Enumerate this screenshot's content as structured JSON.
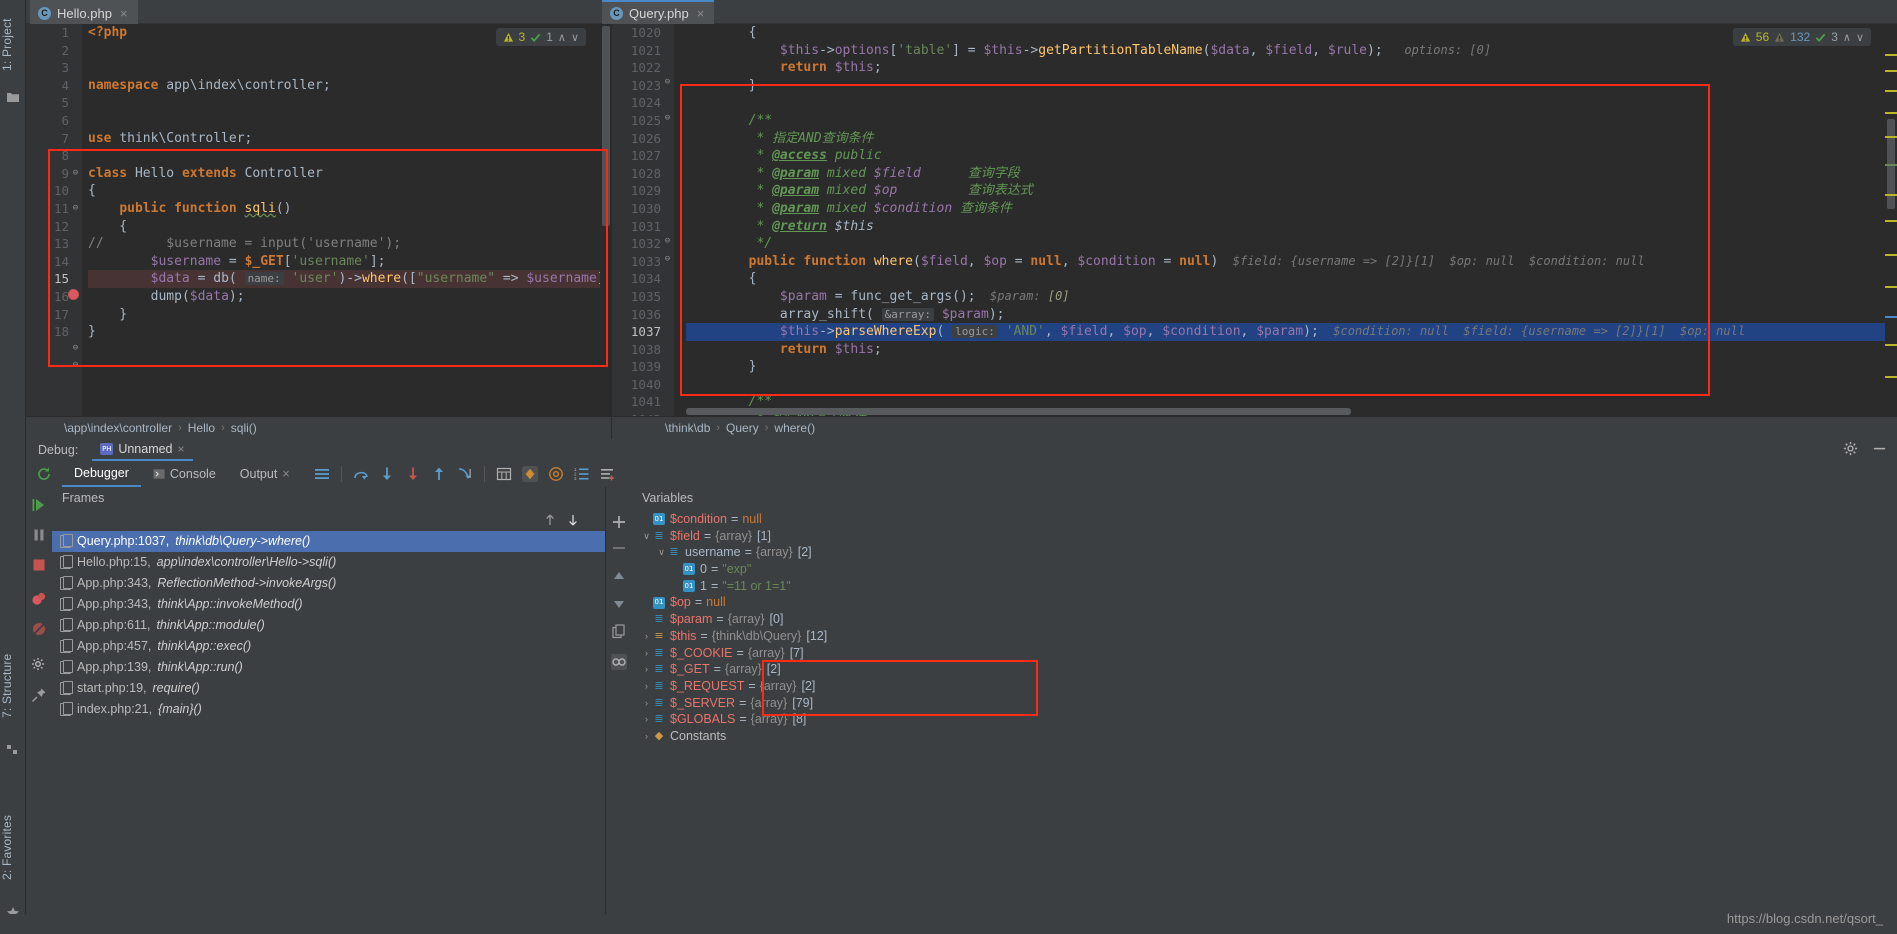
{
  "left_strip": {
    "project_label": "1: Project",
    "structure_label": "7: Structure",
    "favorites_label": "2: Favorites",
    "folder_icon": "folder-icon",
    "star_icon": "star-icon"
  },
  "tabs": [
    {
      "label": "Hello.php",
      "icon": "php-class-icon",
      "close": "×",
      "active": false
    },
    {
      "label": "Query.php",
      "icon": "php-class-icon",
      "close": "×",
      "active": true
    }
  ],
  "editor_left": {
    "file": "Hello.php",
    "first_line": 1,
    "breakpoint_line": 15,
    "inspect": {
      "warn_icon": "warning-triangle-icon",
      "warn_count": "3",
      "ok_icon": "check-icon",
      "ok_count": "1",
      "up": "∧",
      "down": "∨"
    },
    "lines": [
      {
        "n": 1,
        "html": "<span class=\"kw\">&lt;?php</span>"
      },
      {
        "n": 2,
        "html": ""
      },
      {
        "n": 3,
        "html": ""
      },
      {
        "n": 4,
        "html": "<span class=\"kw\">namespace</span> <span class=\"gray\">app\\index\\controller</span>;"
      },
      {
        "n": 5,
        "html": ""
      },
      {
        "n": 6,
        "html": ""
      },
      {
        "n": 7,
        "html": "<span class=\"kw\">use</span> <span class=\"gray\">think\\Controller</span>;"
      },
      {
        "n": 8,
        "html": ""
      },
      {
        "n": 9,
        "html": "<span class=\"kw\">class</span> <span class=\"cls\">Hello</span> <span class=\"kw\">extends</span> <span class=\"cls\">Controller</span>"
      },
      {
        "n": 10,
        "html": "{"
      },
      {
        "n": 11,
        "html": "    <span class=\"kw\">public function</span> <span class=\"fn squig\">sqli</span>()"
      },
      {
        "n": 12,
        "html": "    {"
      },
      {
        "n": 13,
        "html": "<span class=\"cmt\">//        $username = input('username');</span>"
      },
      {
        "n": 14,
        "html": "        <span class=\"var\">$username</span> = <span class=\"kw\">$_GET</span>[<span class=\"str\">'username'</span>];"
      },
      {
        "n": 15,
        "html": "        <span class=\"var\">$data</span> = <span class=\"gray\">db</span>( <span class=\"pname\">name:</span> <span class=\"str\">'user'</span>)-&gt;<span class=\"fn\">where</span>([<span class=\"str\">\"username\"</span> =&gt; <span class=\"var\">$username</span>])-&gt;<span class=\"fn squig2\">select</span>();"
      },
      {
        "n": 16,
        "html": "        <span class=\"gray\">dump</span>(<span class=\"var\">$data</span>);"
      },
      {
        "n": 17,
        "html": "    }"
      },
      {
        "n": 18,
        "html": "}"
      }
    ],
    "breadcrumbs": [
      "\\app\\index\\controller",
      "Hello",
      "sqli()"
    ]
  },
  "editor_right": {
    "file": "Query.php",
    "first_line": 1020,
    "selected_line": 1037,
    "inspect": {
      "warn_icon": "warning-triangle-icon",
      "warn_count": "56",
      "warn2_icon": "warning-triangle-gray-icon",
      "warn2_count": "132",
      "ok_icon": "check-icon",
      "ok_count": "3",
      "up": "∧",
      "down": "∨"
    },
    "lines": [
      {
        "n": 1020,
        "html": "        {"
      },
      {
        "n": 1021,
        "html": "            <span class=\"var\">$this</span>-&gt;<span class=\"var\">options</span>[<span class=\"str\">'table'</span>] = <span class=\"var\">$this</span>-&gt;<span class=\"fn\">getPartitionTableName</span>(<span class=\"var\">$data</span>, <span class=\"var\">$field</span>, <span class=\"var\">$rule</span>);<span class=\"hint\">   options: [0]</span>"
      },
      {
        "n": 1022,
        "html": "            <span class=\"kw\">return</span> <span class=\"var\">$this</span>;"
      },
      {
        "n": 1023,
        "html": "        }"
      },
      {
        "n": 1024,
        "html": ""
      },
      {
        "n": 1025,
        "html": "        <span class=\"doc\">/**</span>"
      },
      {
        "n": 1026,
        "html": "         <span class=\"doc\">* 指定AND查询条件</span>"
      },
      {
        "n": 1027,
        "html": "         <span class=\"doc\">* </span><span class=\"doctag\">@access</span><span class=\"doc\"> public</span>"
      },
      {
        "n": 1028,
        "html": "         <span class=\"doc\">* </span><span class=\"doctag\">@param</span><span class=\"doc\"> mixed </span><span class=\"var\" style=\"font-style:italic\">$field</span><span class=\"doc\">      查询字段</span>"
      },
      {
        "n": 1029,
        "html": "         <span class=\"doc\">* </span><span class=\"doctag\">@param</span><span class=\"doc\"> mixed </span><span class=\"var\" style=\"font-style:italic\">$op</span><span class=\"doc\">         查询表达式</span>"
      },
      {
        "n": 1030,
        "html": "         <span class=\"doc\">* </span><span class=\"doctag\">@param</span><span class=\"doc\"> mixed </span><span class=\"var\" style=\"font-style:italic\">$condition</span><span class=\"doc\"> 查询条件</span>"
      },
      {
        "n": 1031,
        "html": "         <span class=\"doc\">* </span><span class=\"doctag\">@return</span><span class=\"doc\"> </span><span class=\"gray\" style=\"font-style:italic\">$this</span>"
      },
      {
        "n": 1032,
        "html": "         <span class=\"doc\">*/</span>"
      },
      {
        "n": 1033,
        "html": "        <span class=\"kw\">public function</span> <span class=\"fn\">where</span>(<span class=\"var\">$field</span>, <span class=\"var\">$op</span> = <span class=\"kw\">null</span>, <span class=\"var\">$condition</span> = <span class=\"kw\">null</span>)<span class=\"hint\">  $field: {username =&gt; [2]}[1]  $op: null  $condition: null</span>"
      },
      {
        "n": 1034,
        "html": "        {"
      },
      {
        "n": 1035,
        "html": "            <span class=\"var\">$param</span> = <span class=\"gray\">func_get_args</span>();<span class=\"hint\">  $param: </span><span class=\"hintv\">[0]</span>"
      },
      {
        "n": 1036,
        "html": "            <span class=\"gray\">array_shift</span>( <span class=\"pname\">&amp;array:</span> <span class=\"var\">$param</span>);"
      },
      {
        "n": 1037,
        "html": "            <span class=\"var\">$this</span>-&gt;<span class=\"fn\">parseWhereExp</span>( <span class=\"pname\">logic:</span> <span class=\"str\">'AND'</span>, <span class=\"var\">$field</span>, <span class=\"var\">$op</span>, <span class=\"var\">$condition</span>, <span class=\"var\">$param</span>);<span class=\"hint\">  $condition: null  $field: {username =&gt; [2]}[1]  $op: null</span>"
      },
      {
        "n": 1038,
        "html": "            <span class=\"kw\">return</span> <span class=\"var\">$this</span>;"
      },
      {
        "n": 1039,
        "html": "        }"
      },
      {
        "n": 1040,
        "html": ""
      },
      {
        "n": 1041,
        "html": "        <span class=\"doc\">/**</span>"
      },
      {
        "n": 1042,
        "html": "         <span class=\"doc\">* 指定OR查询条件</span>"
      }
    ],
    "breadcrumbs": [
      "\\think\\db",
      "Query",
      "where()"
    ]
  },
  "debug": {
    "label": "Debug:",
    "session_name": "Unnamed",
    "session_icon": "php-debug-icon",
    "session_close": "×",
    "settings_icon": "gear-icon",
    "hide_icon": "minimize-icon",
    "rerun_icon": "rerun-icon",
    "tabs": [
      {
        "label": "Debugger",
        "icon": "",
        "active": true
      },
      {
        "label": "Console",
        "icon": "console-icon",
        "active": false
      },
      {
        "label": "Output",
        "icon": "",
        "active": false,
        "close": "×"
      }
    ],
    "toolbar_icons": [
      "layout-icon",
      "step-over-icon",
      "step-into-icon",
      "force-step-into-icon",
      "step-out-icon",
      "run-to-cursor-icon",
      "evaluate-expression-icon",
      "mute-breakpoints-icon",
      "at-icon",
      "watches-icon",
      "settings-list-icon"
    ],
    "side_icons": [
      "resume-icon",
      "pause-icon",
      "stop-icon",
      "view-breakpoints-icon",
      "mute-breakpoints-side-icon",
      "settings-side-icon",
      "pin-icon"
    ],
    "frames": {
      "title": "Frames",
      "up_icon": "arrow-up-icon",
      "down_icon": "arrow-down-icon",
      "rows": [
        {
          "file": "Query.php:1037,",
          "fn": "think\\db\\Query->where()",
          "selected": true
        },
        {
          "file": "Hello.php:15,",
          "fn": "app\\index\\controller\\Hello->sqli()",
          "selected": false
        },
        {
          "file": "App.php:343,",
          "fn": "ReflectionMethod->invokeArgs()",
          "selected": false
        },
        {
          "file": "App.php:343,",
          "fn": "think\\App::invokeMethod()",
          "selected": false
        },
        {
          "file": "App.php:611,",
          "fn": "think\\App::module()",
          "selected": false
        },
        {
          "file": "App.php:457,",
          "fn": "think\\App::exec()",
          "selected": false
        },
        {
          "file": "App.php:139,",
          "fn": "think\\App::run()",
          "selected": false
        },
        {
          "file": "start.php:19,",
          "fn": "require()",
          "selected": false
        },
        {
          "file": "index.php:21,",
          "fn": "{main}()",
          "selected": false
        }
      ]
    },
    "variables": {
      "title": "Variables",
      "add_icon": "plus-icon",
      "remove_icon": "minus-icon",
      "up_icon": "triangle-up-icon",
      "down_icon": "triangle-down-icon",
      "copy_icon": "copy-icon",
      "watch_icon": "watches-toggle-icon",
      "rows": [
        {
          "indent": 0,
          "twisty": "",
          "ico": "prim",
          "glyph": "01",
          "name": "$condition",
          "eq": "=",
          "value": "null",
          "vclass": "vnull"
        },
        {
          "indent": 0,
          "twisty": "∨",
          "ico": "arr",
          "glyph": "≣",
          "name": "$field",
          "eq": "=",
          "type": "{array}",
          "count": "[1]"
        },
        {
          "indent": 1,
          "twisty": "∨",
          "ico": "arr",
          "glyph": "≣",
          "name": "username",
          "nameclass": "key",
          "eq": "=",
          "type": "{array}",
          "count": "[2]"
        },
        {
          "indent": 2,
          "twisty": "",
          "ico": "prim",
          "glyph": "01",
          "name": "0",
          "nameclass": "key",
          "eq": "=",
          "value": "\"exp\"",
          "vclass": "vstr"
        },
        {
          "indent": 2,
          "twisty": "",
          "ico": "prim",
          "glyph": "01",
          "name": "1",
          "nameclass": "key",
          "eq": "=",
          "value": "\"=11 or 1=1\"",
          "vclass": "vstr"
        },
        {
          "indent": 0,
          "twisty": "",
          "ico": "prim",
          "glyph": "01",
          "name": "$op",
          "eq": "=",
          "value": "null",
          "vclass": "vnull"
        },
        {
          "indent": 0,
          "twisty": "",
          "ico": "arr",
          "glyph": "≣",
          "name": "$param",
          "eq": "=",
          "type": "{array}",
          "count": "[0]"
        },
        {
          "indent": 0,
          "twisty": "›",
          "ico": "obj",
          "glyph": "≡",
          "name": "$this",
          "eq": "=",
          "type": "{think\\db\\Query}",
          "count": "[12]"
        },
        {
          "indent": 0,
          "twisty": "›",
          "ico": "arr",
          "glyph": "≣",
          "name": "$_COOKIE",
          "eq": "=",
          "type": "{array}",
          "count": "[7]"
        },
        {
          "indent": 0,
          "twisty": "›",
          "ico": "arr",
          "glyph": "≣",
          "name": "$_GET",
          "eq": "=",
          "type": "{array}",
          "count": "[2]"
        },
        {
          "indent": 0,
          "twisty": "›",
          "ico": "arr",
          "glyph": "≣",
          "name": "$_REQUEST",
          "eq": "=",
          "type": "{array}",
          "count": "[2]"
        },
        {
          "indent": 0,
          "twisty": "›",
          "ico": "arr",
          "glyph": "≣",
          "name": "$_SERVER",
          "eq": "=",
          "type": "{array}",
          "count": "[79]"
        },
        {
          "indent": 0,
          "twisty": "›",
          "ico": "arr",
          "glyph": "≣",
          "name": "$GLOBALS",
          "eq": "=",
          "type": "{array}",
          "count": "[8]"
        },
        {
          "indent": 0,
          "twisty": "›",
          "ico": "const",
          "glyph": "◆",
          "name": "Constants",
          "nameclass": "const"
        }
      ]
    }
  },
  "watermark": "https://blog.csdn.net/qsort_",
  "colors": {
    "accent_blue": "#4a88c7",
    "selection_blue": "#214283",
    "frame_selected": "#4b6eaf",
    "annotation_red": "#ff2a15",
    "editor_bg": "#2b2b2b",
    "panel_bg": "#3c3f41"
  }
}
